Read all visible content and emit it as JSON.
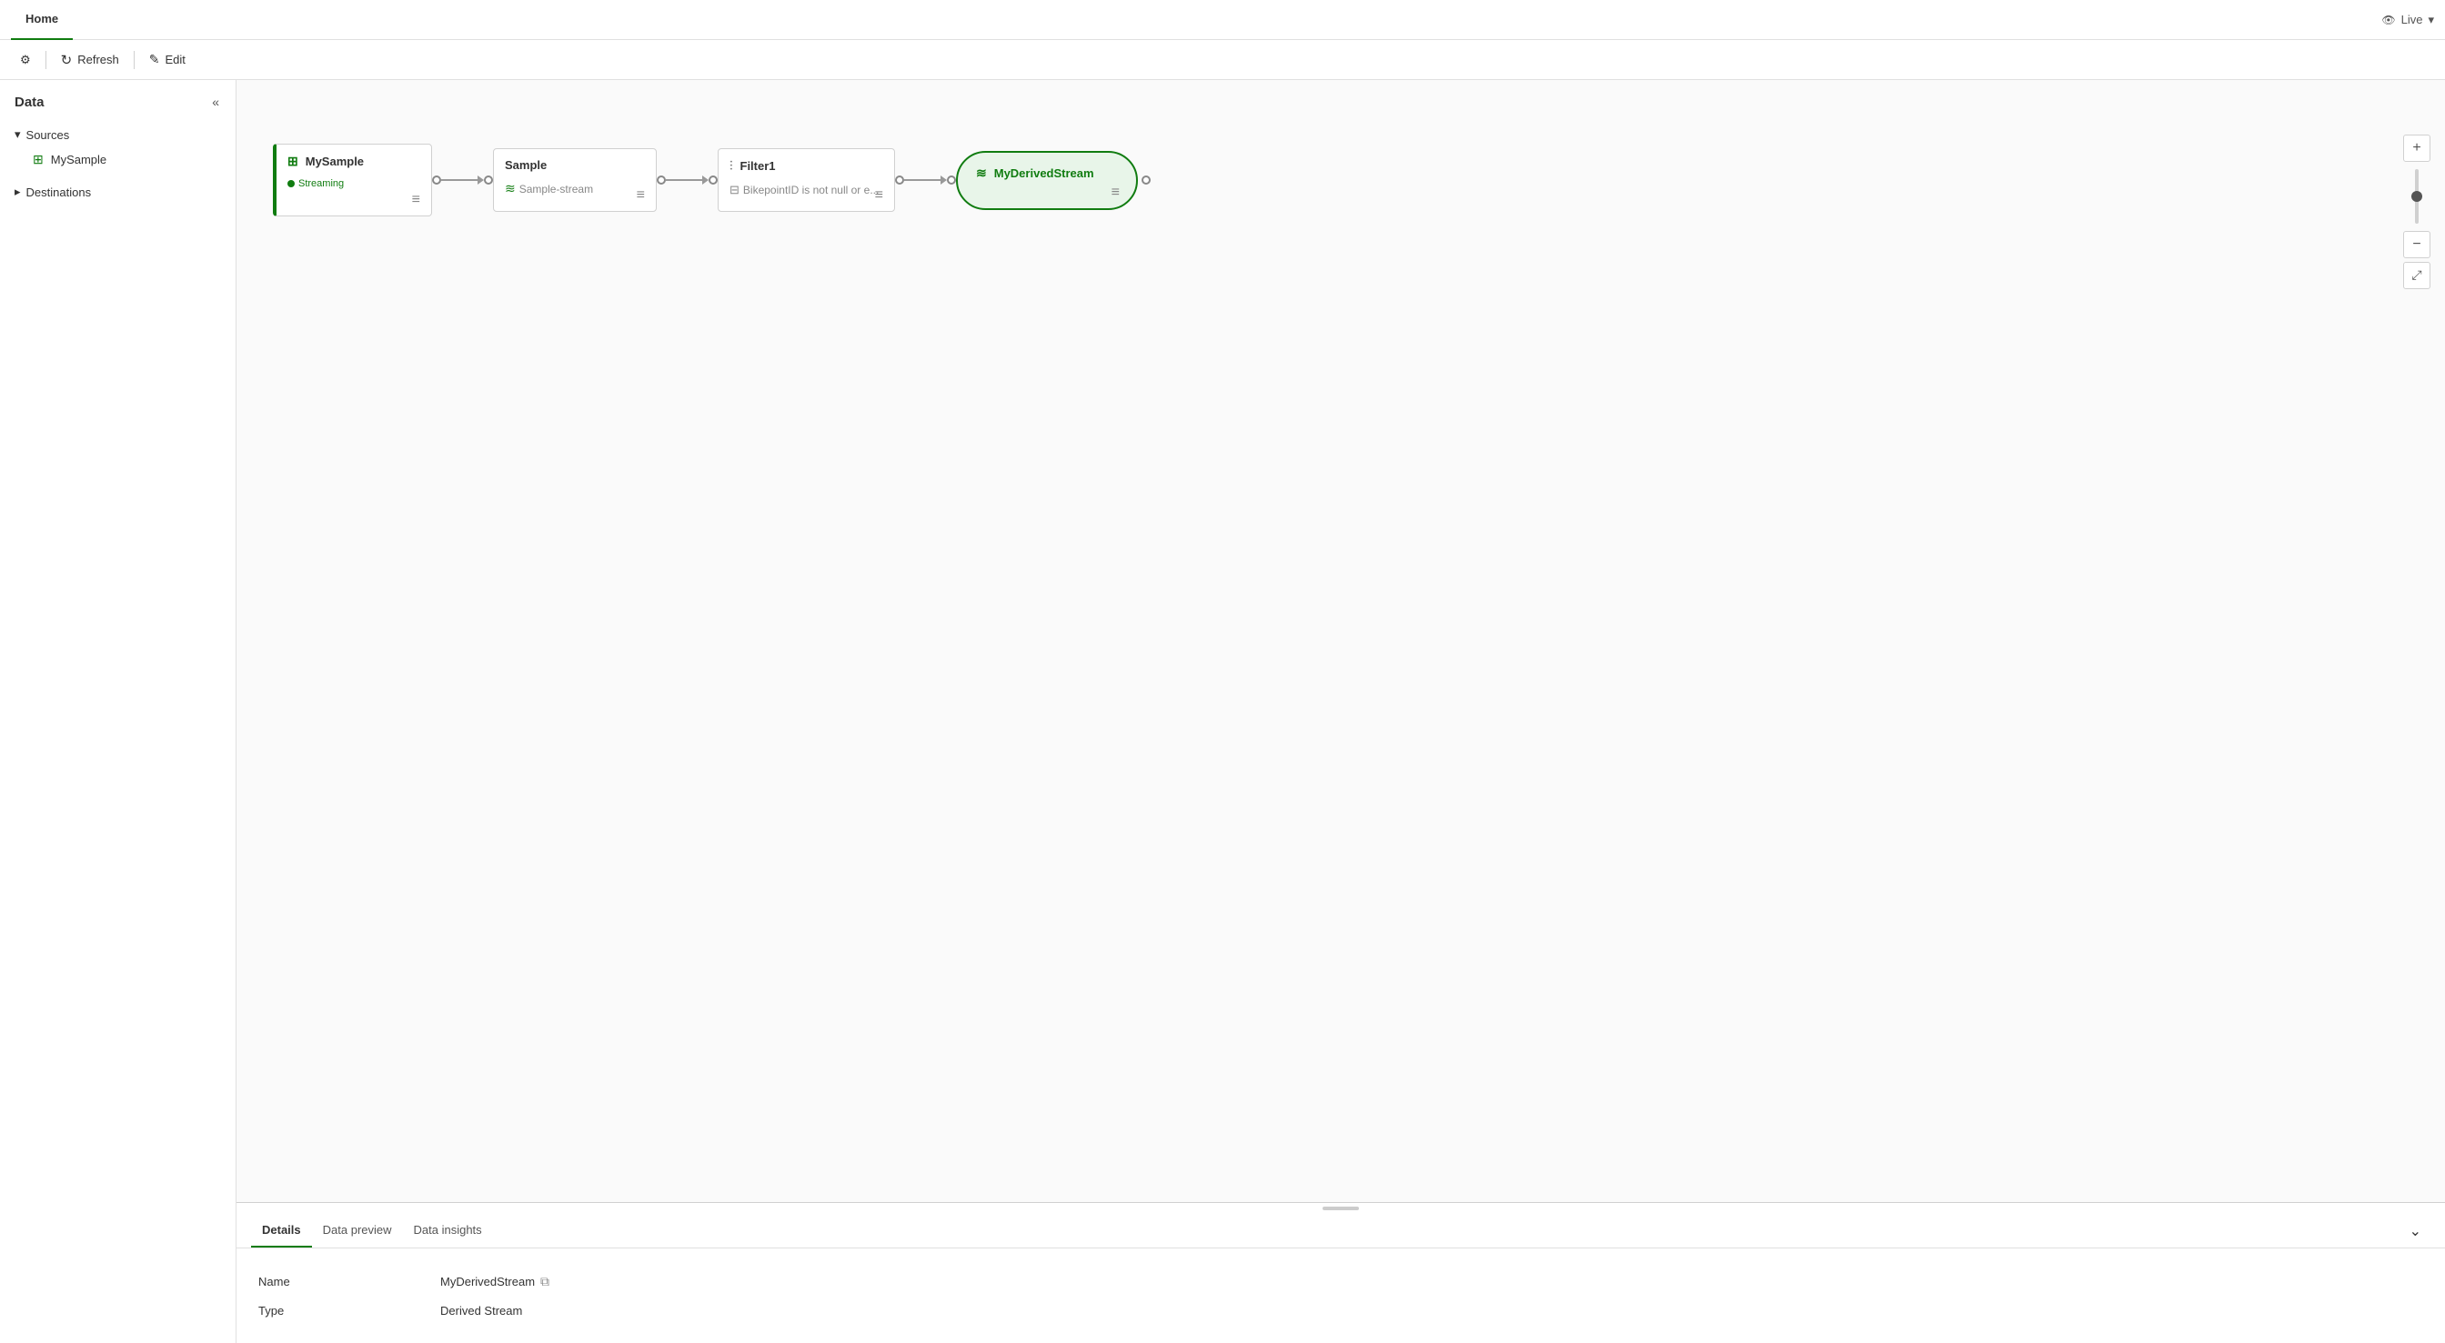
{
  "topNav": {
    "tabs": [
      {
        "label": "Home",
        "active": true
      }
    ],
    "liveLabel": "Live",
    "liveDropdown": true
  },
  "toolbar": {
    "gearLabel": "",
    "refreshLabel": "Refresh",
    "editLabel": "Edit"
  },
  "sidebar": {
    "title": "Data",
    "sections": [
      {
        "label": "Sources",
        "expanded": true,
        "items": [
          {
            "label": "MySample",
            "icon": "table"
          }
        ]
      },
      {
        "label": "Destinations",
        "expanded": false,
        "items": []
      }
    ]
  },
  "flow": {
    "nodes": [
      {
        "id": "source",
        "type": "source",
        "title": "MySample",
        "badge": "Streaming",
        "icon": "table"
      },
      {
        "id": "transform",
        "type": "transform",
        "title": "Sample",
        "subtitle": "Sample-stream",
        "icon": "stream"
      },
      {
        "id": "filter",
        "type": "filter",
        "title": "Filter1",
        "subtitle": "BikepointID is not null or e...",
        "icon": "filter"
      },
      {
        "id": "destination",
        "type": "destination",
        "title": "MyDerivedStream",
        "icon": "stream"
      }
    ]
  },
  "bottomPanel": {
    "tabs": [
      {
        "label": "Details",
        "active": true
      },
      {
        "label": "Data preview",
        "active": false
      },
      {
        "label": "Data insights",
        "active": false
      }
    ],
    "details": {
      "nameLabel": "Name",
      "nameValue": "MyDerivedStream",
      "typeLabel": "Type",
      "typeValue": "Derived Stream"
    }
  },
  "zoomControls": {
    "plusLabel": "+",
    "minusLabel": "−",
    "fitLabel": "⤢"
  }
}
